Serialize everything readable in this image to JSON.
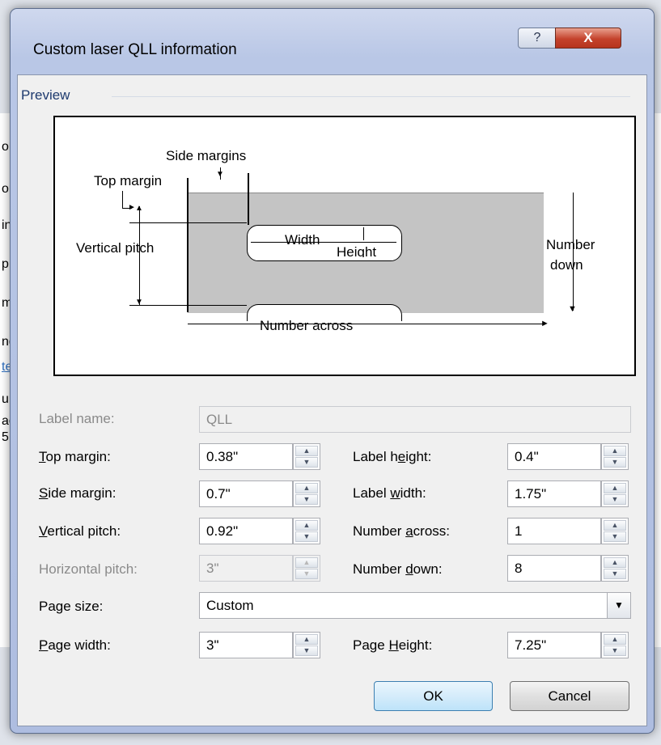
{
  "dialog": {
    "title": "Custom laser QLL information",
    "help_glyph": "?",
    "close_glyph": "X"
  },
  "preview": {
    "section_label": "Preview",
    "diagram": {
      "side_margins": "Side margins",
      "top_margin": "Top margin",
      "vertical_pitch": "Vertical pitch",
      "width": "Width",
      "height": "Height",
      "number_down_1": "Number",
      "number_down_2": "down",
      "number_across": "Number across"
    }
  },
  "form": {
    "label_name": {
      "label": "Label name:",
      "value": "QLL"
    },
    "top_margin": {
      "label_pre": "",
      "label_u": "T",
      "label_post": "op margin:",
      "value": "0.38\""
    },
    "side_margin": {
      "label_u": "S",
      "label_post": "ide margin:",
      "value": "0.7\""
    },
    "vertical_pitch": {
      "label_u": "V",
      "label_post": "ertical pitch:",
      "value": "0.92\""
    },
    "horizontal_pitch": {
      "label": "Horizontal pitch:",
      "value": "3\""
    },
    "page_size": {
      "label": "Page size:",
      "value": "Custom"
    },
    "page_width": {
      "label_u": "P",
      "label_post": "age width:",
      "value": "3\""
    },
    "label_height": {
      "label_pre": "Label h",
      "label_u": "e",
      "label_post": "ight:",
      "value": "0.4\""
    },
    "label_width": {
      "label_pre": "Label ",
      "label_u": "w",
      "label_post": "idth:",
      "value": "1.75\""
    },
    "number_across": {
      "label_pre": "Number ",
      "label_u": "a",
      "label_post": "cross:",
      "value": "1"
    },
    "number_down": {
      "label_pre": "Number ",
      "label_u": "d",
      "label_post": "own:",
      "value": "8"
    },
    "page_height": {
      "label_pre": "Page ",
      "label_u": "H",
      "label_post": "eight:",
      "value": "7.25\""
    }
  },
  "buttons": {
    "ok": "OK",
    "cancel": "Cancel"
  },
  "background": {
    "left_fragments": [
      "o",
      "or",
      "in",
      "p",
      "m",
      "nd",
      "te",
      "um",
      "ac",
      "5"
    ]
  }
}
